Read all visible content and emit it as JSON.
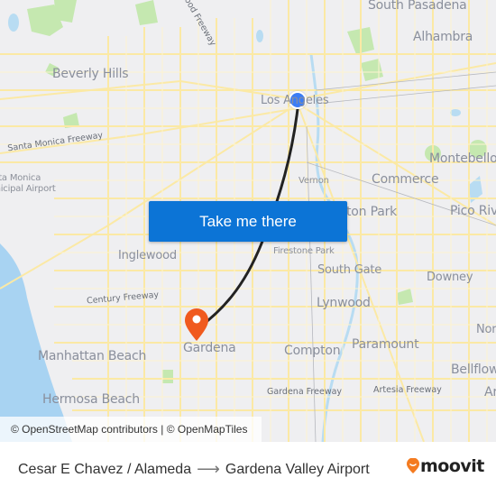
{
  "map": {
    "places": [
      {
        "name": "South Pasadena",
        "size": "big"
      },
      {
        "name": "Alhambra",
        "size": "big"
      },
      {
        "name": "Beverly Hills",
        "size": "big"
      },
      {
        "name": "Los Angeles",
        "size": "med"
      },
      {
        "name": "Montebello",
        "size": "big"
      },
      {
        "name": "Santa Monica Municipal Airport",
        "size": "small"
      },
      {
        "name": "Vernon",
        "size": "small"
      },
      {
        "name": "Commerce",
        "size": "big"
      },
      {
        "name": "Huntington Park",
        "size": "big"
      },
      {
        "name": "Pico Rivera",
        "size": "big"
      },
      {
        "name": "Firestone Park",
        "size": "small"
      },
      {
        "name": "Inglewood",
        "size": "med"
      },
      {
        "name": "South Gate",
        "size": "med"
      },
      {
        "name": "Downey",
        "size": "med"
      },
      {
        "name": "Lynwood",
        "size": "big"
      },
      {
        "name": "Norwalk",
        "size": "med"
      },
      {
        "name": "Gardena",
        "size": "big"
      },
      {
        "name": "Compton",
        "size": "big"
      },
      {
        "name": "Paramount",
        "size": "big"
      },
      {
        "name": "Manhattan Beach",
        "size": "big"
      },
      {
        "name": "Bellflower",
        "size": "big"
      },
      {
        "name": "Hermosa Beach",
        "size": "big"
      },
      {
        "name": "Artesia",
        "size": "big"
      }
    ],
    "roads": [
      "Hollywood Freeway",
      "Santa Monica Freeway",
      "Century Freeway",
      "Gardena Freeway",
      "Artesia Freeway"
    ],
    "origin_marker": {
      "label": "Cesar E Chavez / Alameda",
      "color": "#3b7df5"
    },
    "destination_marker": {
      "label": "Gardena Valley Airport",
      "color": "#f05a1e"
    },
    "route_color": "#222222",
    "attribution": "© OpenStreetMap contributors | © OpenMapTiles"
  },
  "cta": {
    "label": "Take me there",
    "color": "#0c74d6"
  },
  "footer": {
    "origin": "Cesar E Chavez / Alameda",
    "arrow": "⟶",
    "destination": "Gardena Valley Airport",
    "brand": "moovit",
    "brand_color": "#f47b20"
  }
}
